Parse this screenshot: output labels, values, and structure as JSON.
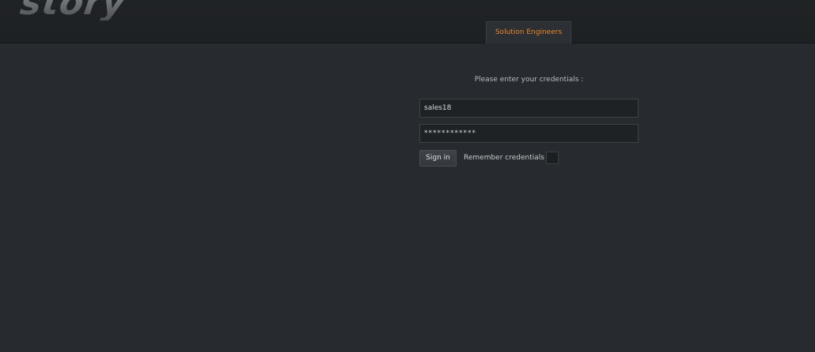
{
  "header": {
    "logo_text": "story",
    "tab_label": "Solution Engineers",
    "accent_color": "#e8872e"
  },
  "login": {
    "prompt": "Please enter your credentials :",
    "username_value": "sales18",
    "password_value": "************",
    "sign_in_label": "Sign in",
    "remember_label": "Remember credentials",
    "remember_checked": false
  }
}
